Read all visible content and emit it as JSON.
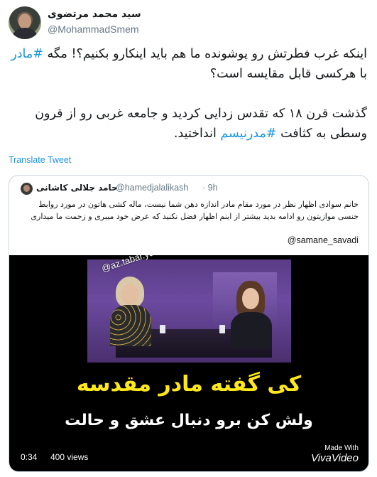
{
  "author": {
    "display_name": "سید محمد مرتضوی",
    "handle": "@MohammadSmem"
  },
  "tweet": {
    "line1_pre": "اینکه غرب فطرتش رو پوشونده ما هم باید اینکارو بکنیم؟! مگه ",
    "line1_hashtag": "#مادر",
    "line1_post": " با هرکسی قابل مقایسه است؟",
    "line2_pre": "گذشت قرن ۱۸ که تقدس زدایی کردید و جامعه غربی رو از قرون وسطی به کثافت ",
    "line2_hashtag": "#مدرنیسم",
    "line2_post": " انداختید."
  },
  "translate_label": "Translate Tweet",
  "quoted": {
    "display_name": "حامد جلالی کاشانی",
    "handle": "@hamedjalalikash",
    "time": "· 9h",
    "text": "خانم سوادی اظهار نظر در مورد مقام مادر اندازه دهن شما نیست، ماله کشی هاتون در مورد روابط جنسی موازیتون رو ادامه بدید بیشتر از اینم اظهار فضل نکنید که عرض خود میبری و زحمت ما میداری",
    "mention": "@samane_savadi"
  },
  "video": {
    "watermark": "@az.tabar.yas",
    "caption_line1": "کی گفته مادر مقدسه",
    "caption_line2": "ولش کن برو دنبال عشق و حالت",
    "made_with": "Made With",
    "brand": "VivaVideo",
    "duration": "0:34",
    "views": "400 views"
  }
}
